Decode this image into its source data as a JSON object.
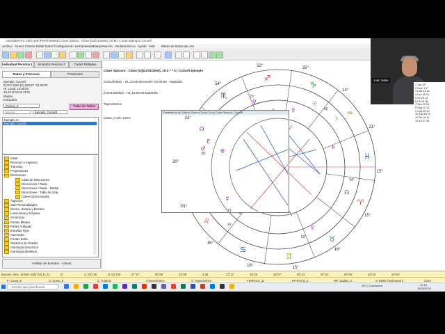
{
  "app": {
    "title": "Astrolabe Pro Cabi HvB [PANTOMINE] Clave Spikes - Clave [01/01/2000], 00:M7 A Juan Ejemplo Cursoft",
    "menu": [
      "Archivo",
      "Nuevo Chame",
      "Editar Datos",
      "Configuración",
      "Herramientas",
      "Interpretación",
      "Ventana",
      "Sincro",
      "Ayuda",
      "Salir",
      "Bases de Datos de Uso"
    ]
  },
  "left": {
    "top_tabs": [
      "Individual Persona 1",
      "Sinastría Persona 2",
      "Cartas Múltiples"
    ],
    "sub_tabs": [
      "Datos y Procesos",
      "Posiciones"
    ],
    "info_lines": [
      "Ejemplo, Cursoft",
      "01/01/ 2000 [G] DGMT: -01:00:00",
      "Hr. Local: 12:00:00",
      "40.23 N 03.40.29 W",
      "Madrid",
      "E-España"
    ],
    "curso_value": "Cursos_8",
    "search_placeholder": "Buscar",
    "search_value": "Ejemplo, Cursoft",
    "all_tables_button": "Todas las Tablas",
    "list_header": "Ejemplo AI:",
    "list_selected": "Ejemplo, Cursoft",
    "tree_items": [
      "Natal",
      "Retornos e Ingresos",
      "Tránsitos",
      "Progresiones",
      "Direcciones",
      "Carta de Direcciones",
      "Direcciones / Radix",
      "Direcciones / Radix - Radial",
      "Direcciones - Tabla de Vida",
      "Claves Direccionales",
      "Aspectos",
      "Sub-Personalidades",
      "Diurna, Horaria y Electiva",
      "Lunaciones y Eclipses",
      "Armónicos",
      "Puntos Medios",
      "Partes Arábigas",
      "Estrellas Fijas",
      "Asteroides",
      "Puntos Extra",
      "Símbolos de Grados",
      "Astrología Dracónica",
      "Astrología Medieval"
    ],
    "analysis_button": "Análisis de Eventos - Activar"
  },
  "chart_header": {
    "lines": [
      "Clave Spicuos - Clave [G][01/01/2000], 10:4 * * A | Cursoft Ejemplo",
      "01/01/2000G - HL:12:00:00-DGMT:-01:00:00 - Madrid/E",
      "[01/01/2000]G - HL:12:00:00-Madrid/E",
      "Topocéntrico",
      "Clase_0 orb. 100%"
    ]
  },
  "popup_title": "Parámetros de Cálculo Cierre (Cursor Cruz) Clave Spicuos, Cursoft",
  "wheel": {
    "labels_outer": [
      "22°",
      "25°",
      "14°",
      "21°",
      "15°",
      "15°",
      "16°",
      "15°",
      "16°",
      "15°",
      "03°",
      "20°",
      "22°",
      "54°"
    ],
    "cusp_labels": [
      "54'",
      "53'",
      "16'",
      "06'",
      "23'",
      "41'"
    ]
  },
  "webcam": {
    "name_tag": "Juan Saba"
  },
  "planet_table": [
    "1 Tau 43°",
    "2 Gem 1 1°",
    "3 Can 03 14",
    "4 Leo 55 01",
    "5 Vir 20 12",
    "6 Lib 04 30",
    "7 Sco 22 25",
    "8 Sag 29 13",
    "9 Cap 05 40",
    "10 Aqu 20 20",
    "11 Pis 04 11",
    "12 Ari 07 33"
  ],
  "status_bar_1": [
    "Buenos Aires, 18 Mar 2022 (VI) 11:12",
    "D: ",
    "A: 00°12b",
    "H: 00°12b",
    "27°47'",
    "06°09'",
    "22°48'",
    "3.36",
    "23°17'",
    "46°25",
    "26°07'",
    "00°14'",
    "00°52'",
    "00°59'",
    "24°44'",
    "23°53'"
  ],
  "status_bar_2": [
    "P: Curso_8",
    "C: Curso_8",
    "Z: Tropical",
    "S:Geocéntrico",
    "C: Topocéntrico",
    "FSIRGCS_11",
    "FP:RGCS_3",
    "MP: Zodiac_8",
    "S: Estilo Tradicional 2",
    "Color"
  ],
  "taskbar": {
    "search_placeholder": "Escribe aquí para buscar",
    "weather": "16°C Chubascos",
    "time": "11:13",
    "date": "18/03/2022"
  },
  "colors": {
    "selection": "#1f78d1",
    "status_bg": "#fdf1bd",
    "chart_red": "#d63c3c",
    "chart_blue": "#2550c8",
    "chart_green": "#2e9a3d",
    "glyph_purple": "#8a2aa6"
  }
}
